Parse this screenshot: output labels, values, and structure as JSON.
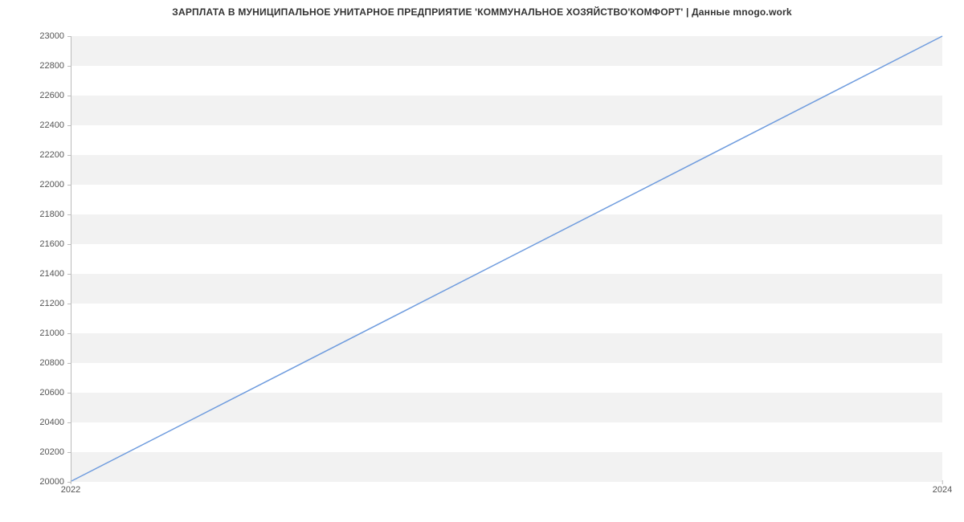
{
  "chart_data": {
    "type": "line",
    "title": "ЗАРПЛАТА В МУНИЦИПАЛЬНОЕ УНИТАРНОЕ ПРЕДПРИЯТИЕ 'КОММУНАЛЬНОЕ ХОЗЯЙСТВО'КОМФОРТ' | Данные mnogo.work",
    "xlabel": "",
    "ylabel": "",
    "x": [
      2022,
      2024
    ],
    "y": [
      20000,
      23000
    ],
    "xticks": [
      "2022",
      "2024"
    ],
    "yticks": [
      "20000",
      "20200",
      "20400",
      "20600",
      "20800",
      "21000",
      "21200",
      "21400",
      "21600",
      "21800",
      "22000",
      "22200",
      "22400",
      "22600",
      "22800",
      "23000"
    ],
    "xlim": [
      2022,
      2024
    ],
    "ylim": [
      20000,
      23000
    ],
    "grid": "banded",
    "line_color": "#6f9cde"
  }
}
